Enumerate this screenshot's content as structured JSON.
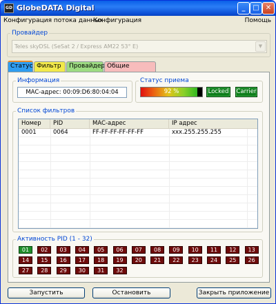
{
  "window": {
    "title": "GlobeDATA Digital",
    "icon_text": "GD",
    "controls": {
      "minimize": "_",
      "maximize": "□",
      "close": "✕"
    }
  },
  "menu": {
    "items": [
      "Конфигурация потока данных",
      "Конфигурация"
    ],
    "help": "Помощь"
  },
  "provider_group": {
    "title": "Провайдер",
    "selected": "Teles skyDSL (SeSat 2 / Express AM22 53° E)"
  },
  "tabs": [
    "Статус",
    "Фильтр",
    "Провайдер",
    "Общие настройки"
  ],
  "info": {
    "title": "Информация",
    "mac_text": "MAC-адрес: 00:09:D6:80:04:04"
  },
  "reception": {
    "title": "Статус приема",
    "signal_percent": 92,
    "signal_text": "92 %",
    "locked": "Locked",
    "carrier": "Carrier"
  },
  "filters": {
    "title": "Список фильтров",
    "columns": [
      "Номер",
      "PID",
      "MAC-адрес",
      "IP адрес"
    ],
    "rows": [
      [
        "0001",
        "0064",
        "FF-FF-FF-FF-FF-FF",
        "xxx.255.255.255"
      ]
    ],
    "empty_rows": 11
  },
  "pid_activity": {
    "title": "Активность PID (1 - 32)",
    "pids": [
      "01",
      "02",
      "03",
      "04",
      "05",
      "06",
      "07",
      "08",
      "09",
      "10",
      "11",
      "12",
      "13",
      "14",
      "15",
      "16",
      "17",
      "18",
      "19",
      "20",
      "21",
      "22",
      "23",
      "24",
      "25",
      "26",
      "27",
      "28",
      "29",
      "30",
      "31",
      "32"
    ],
    "active": [
      "01"
    ],
    "colors": {
      "active": "#1F8E2A",
      "inactive": "#6E0B0B"
    }
  },
  "buttons": {
    "start": "Запустить",
    "stop": "Остановить",
    "close_app": "Закрыть приложение"
  }
}
